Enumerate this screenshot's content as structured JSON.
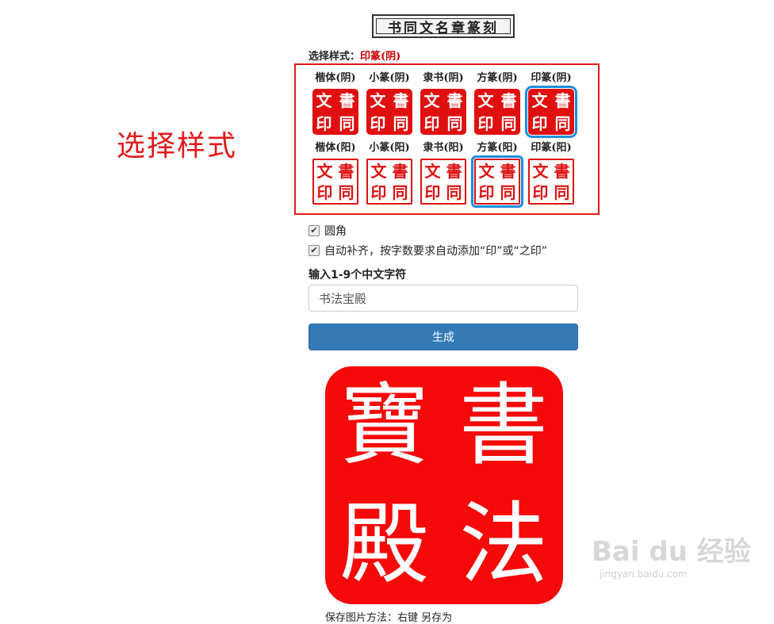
{
  "header": {
    "title": "书同文名章篆刻"
  },
  "style_selector": {
    "label": "选择样式：",
    "selected_value": "印篆(阴)",
    "rows": [
      [
        {
          "label": "楷体(阴)",
          "glyphs": [
            "書",
            "文",
            "同",
            "印"
          ]
        },
        {
          "label": "小篆(阴)",
          "glyphs": [
            "書",
            "文",
            "同",
            "印"
          ]
        },
        {
          "label": "隶书(阴)",
          "glyphs": [
            "書",
            "文",
            "同",
            "印"
          ]
        },
        {
          "label": "方篆(阴)",
          "glyphs": [
            "書",
            "文",
            "同",
            "印"
          ]
        },
        {
          "label": "印篆(阴)",
          "glyphs": [
            "書",
            "文",
            "同",
            "印"
          ]
        }
      ],
      [
        {
          "label": "楷体(阳)",
          "glyphs": [
            "書",
            "文",
            "同",
            "印"
          ]
        },
        {
          "label": "小篆(阳)",
          "glyphs": [
            "書",
            "文",
            "同",
            "印"
          ]
        },
        {
          "label": "隶书(阳)",
          "glyphs": [
            "書",
            "文",
            "同",
            "印"
          ]
        },
        {
          "label": "方篆(阳)",
          "glyphs": [
            "書",
            "文",
            "同",
            "印"
          ]
        },
        {
          "label": "印篆(阳)",
          "glyphs": [
            "書",
            "文",
            "同",
            "印"
          ]
        }
      ]
    ]
  },
  "annotation": {
    "text": "选择样式"
  },
  "options": {
    "rounded_label": "圆角",
    "autofill_label": "自动补齐，按字数要求自动添加“印”或“之印”",
    "check_mark": "✔"
  },
  "input": {
    "label": "输入1-9个中文字符",
    "value": "书法宝殿"
  },
  "generate": {
    "label": "生成"
  },
  "result": {
    "glyphs": [
      "書",
      "法",
      "寶",
      "殿"
    ]
  },
  "footer": {
    "partial_text": "保存图片方法：右键 另存为"
  },
  "watermark": {
    "main": "Bai du 经验",
    "sub": "jingyan.baidu.com"
  },
  "colors": {
    "seal_red": "#f50909",
    "frame_red": "#e11a1a",
    "selection_blue": "#1a8fe0",
    "button_blue": "#337ab7"
  }
}
